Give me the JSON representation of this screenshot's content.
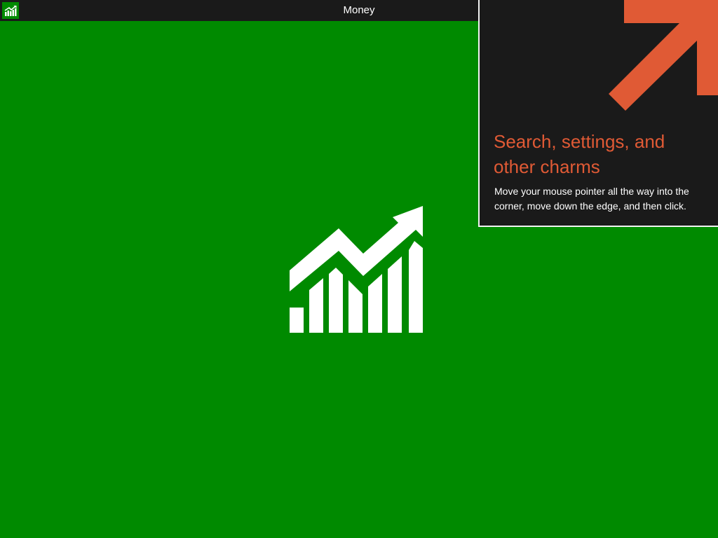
{
  "window": {
    "title": "Money",
    "app_icon": "money-chart-icon"
  },
  "splash": {
    "logo_icon": "rising-chart-arrow-icon",
    "background_color": "#008a00",
    "logo_color": "#ffffff"
  },
  "tip": {
    "heading": "Search, settings, and other charms",
    "body": "Move your mouse pointer all the way into the corner, move down the edge, and then click.",
    "arrow_icon": "diagonal-up-right-arrow-icon",
    "accent_color": "#e05a35",
    "background_color": "#1a1a1a"
  }
}
